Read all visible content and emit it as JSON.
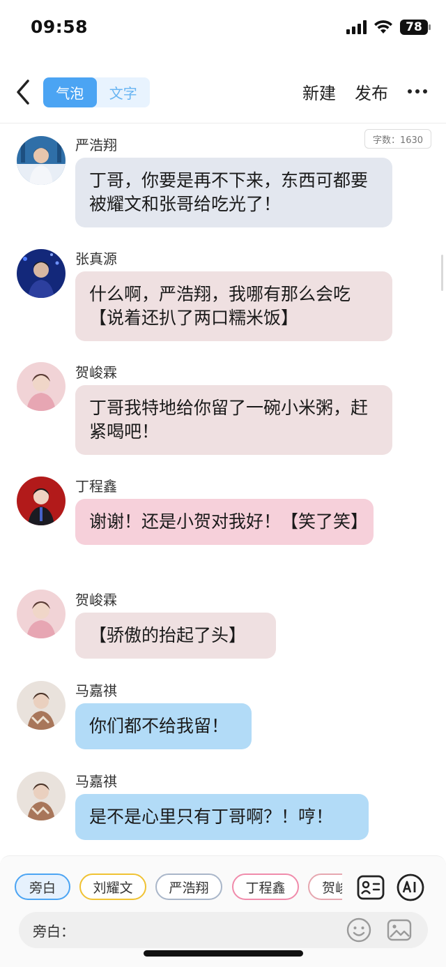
{
  "status": {
    "time": "09:58",
    "battery": "78"
  },
  "nav": {
    "tabs": [
      {
        "label": "气泡",
        "active": true
      },
      {
        "label": "文字",
        "active": false
      }
    ],
    "new_label": "新建",
    "publish_label": "发布"
  },
  "word_count": "字数：1630",
  "messages": [
    {
      "speaker": "严浩翔",
      "text": "丁哥，你要是再不下来，东西可都要被耀文和张哥给吃光了！",
      "bubble_color": "#e3e7ef"
    },
    {
      "speaker": "张真源",
      "text": "什么啊，严浩翔，我哪有那么会吃【说着还扒了两口糯米饭】",
      "bubble_color": "#efe0e1"
    },
    {
      "speaker": "贺峻霖",
      "text": "丁哥我特地给你留了一碗小米粥，赶紧喝吧！",
      "bubble_color": "#efe0e1"
    },
    {
      "speaker": "丁程鑫",
      "text": "谢谢！还是小贺对我好！【笑了笑】",
      "bubble_color": "#f6d0da"
    },
    {
      "speaker": "贺峻霖",
      "text": "【骄傲的抬起了头】",
      "bubble_color": "#efe0e1"
    },
    {
      "speaker": "马嘉祺",
      "text": "你们都不给我留！",
      "bubble_color": "#b2dbf7"
    },
    {
      "speaker": "马嘉祺",
      "text": "是不是心里只有丁哥啊？！哼！",
      "bubble_color": "#b2dbf7"
    }
  ],
  "characters": [
    {
      "label": "旁白",
      "color": "#4ba4f3",
      "active": true
    },
    {
      "label": "刘耀文",
      "color": "#f0c233",
      "active": false
    },
    {
      "label": "严浩翔",
      "color": "#a9b6c9",
      "active": false
    },
    {
      "label": "丁程鑫",
      "color": "#f08bab",
      "active": false
    },
    {
      "label": "贺峻霖",
      "color": "#e6a7b0",
      "active": false
    }
  ],
  "input": {
    "label": "旁白：",
    "value": ""
  },
  "colors": {
    "accent": "#4ba4f3"
  }
}
